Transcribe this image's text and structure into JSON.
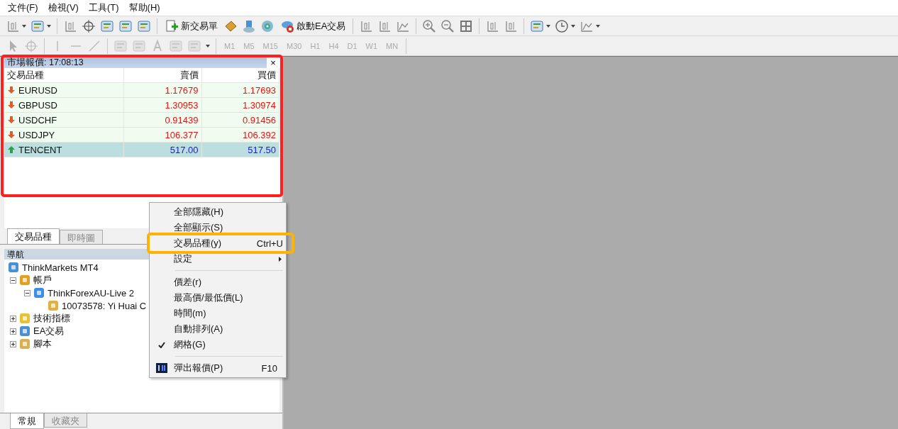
{
  "menu_bar": [
    "文件(F)",
    "檢視(V)",
    "工具(T)",
    "幫助(H)"
  ],
  "toolbar": {
    "new_order": "新交易單",
    "expert_advisors": "啟動EA交易"
  },
  "timeframes": [
    {
      "label": "M1",
      "disabled": true
    },
    {
      "label": "M5",
      "disabled": true
    },
    {
      "label": "M15",
      "disabled": true
    },
    {
      "label": "M30",
      "disabled": true
    },
    {
      "label": "H1",
      "disabled": true
    },
    {
      "label": "H4",
      "disabled": true
    },
    {
      "label": "D1",
      "disabled": true
    },
    {
      "label": "W1",
      "disabled": true
    },
    {
      "label": "MN",
      "disabled": true
    }
  ],
  "market_watch": {
    "title": "市場報價: 17:08:13",
    "close": "×",
    "highlighted": true,
    "columns": [
      "交易品種",
      "賣價",
      "買價"
    ],
    "rows": [
      {
        "symbol": "EURUSD",
        "bid": "1.17679",
        "ask": "1.17693",
        "rising": false,
        "selected": false
      },
      {
        "symbol": "GBPUSD",
        "bid": "1.30953",
        "ask": "1.30974",
        "rising": false,
        "selected": false
      },
      {
        "symbol": "USDCHF",
        "bid": "0.91439",
        "ask": "0.91456",
        "rising": false,
        "selected": false
      },
      {
        "symbol": "USDJPY",
        "bid": "106.377",
        "ask": "106.392",
        "rising": false,
        "selected": false
      },
      {
        "symbol": "TENCENT",
        "bid": "517.00",
        "ask": "517.50",
        "rising": true,
        "selected": true
      }
    ],
    "tabs": [
      {
        "label": "交易品種",
        "selected": true
      },
      {
        "label": "即時圖",
        "selected": false
      }
    ]
  },
  "navigator": {
    "title": "導航",
    "tree": [
      {
        "label": "ThinkMarkets MT4",
        "kind": "terminal",
        "children": [
          {
            "label": "帳戶",
            "kind": "accounts",
            "expanded": true,
            "children": [
              {
                "label": "ThinkForexAU-Live 2",
                "kind": "server",
                "expanded": true,
                "children": [
                  {
                    "label": "10073578: Yi Huai C",
                    "kind": "account"
                  }
                ]
              }
            ]
          },
          {
            "label": "技術指標",
            "kind": "indicators",
            "expanded": false
          },
          {
            "label": "EA交易",
            "kind": "experts",
            "expanded": false
          },
          {
            "label": "腳本",
            "kind": "scripts",
            "expanded": false
          }
        ]
      }
    ],
    "tabs": [
      {
        "label": "常規",
        "selected": true
      },
      {
        "label": "收藏夾",
        "selected": false
      }
    ]
  },
  "context_menu": {
    "items": [
      {
        "kind": "item",
        "label": "全部隱藏(H)",
        "checked": false,
        "submenu": false,
        "highlighted": false
      },
      {
        "kind": "item",
        "label": "全部顯示(S)",
        "checked": false,
        "submenu": false,
        "highlighted": false
      },
      {
        "kind": "item",
        "label": "交易品種(y)",
        "shortcut": "Ctrl+U",
        "checked": false,
        "submenu": false,
        "highlighted": true
      },
      {
        "kind": "item",
        "label": "設定",
        "checked": false,
        "submenu": true,
        "highlighted": false
      },
      {
        "kind": "separator"
      },
      {
        "kind": "item",
        "label": "價差(r)",
        "checked": false,
        "submenu": false,
        "highlighted": false
      },
      {
        "kind": "item",
        "label": "最高價/最低價(L)",
        "checked": false,
        "submenu": false,
        "highlighted": false
      },
      {
        "kind": "item",
        "label": "時間(m)",
        "checked": false,
        "submenu": false,
        "highlighted": false
      },
      {
        "kind": "item",
        "label": "自動排列(A)",
        "checked": false,
        "submenu": false,
        "highlighted": false
      },
      {
        "kind": "item",
        "label": "網格(G)",
        "checked": true,
        "submenu": false,
        "highlighted": false
      },
      {
        "kind": "separator"
      },
      {
        "kind": "icon-item",
        "label": "彈出報價(P)",
        "shortcut": "F10",
        "checked": false,
        "submenu": false,
        "highlighted": false
      }
    ]
  }
}
